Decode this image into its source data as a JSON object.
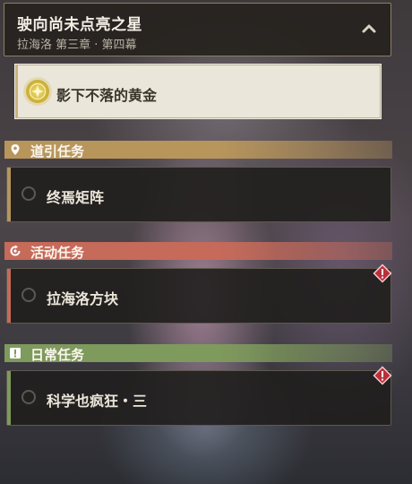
{
  "header": {
    "title": "驶向尚未点亮之星",
    "subtitle": "拉海洛 第三章 · 第四幕",
    "collapse_icon": "chevron-up-icon"
  },
  "featured_quest": {
    "label": "影下不落的黄金",
    "icon": "star-target-icon",
    "accent_color": "#c9b27a"
  },
  "categories": [
    {
      "label": "道引任务",
      "icon": "location-pin-icon",
      "color": "#b8955b",
      "quests": [
        {
          "label": "终焉矩阵",
          "has_alert": false
        }
      ]
    },
    {
      "label": "活动任务",
      "icon": "event-swirl-icon",
      "color": "#c66a5a",
      "quests": [
        {
          "label": "拉海洛方块",
          "has_alert": true
        }
      ]
    },
    {
      "label": "日常任务",
      "icon": "daily-exclamation-icon",
      "color": "#7e9a5c",
      "quests": [
        {
          "label": "科学也疯狂・三",
          "has_alert": true
        }
      ]
    }
  ]
}
